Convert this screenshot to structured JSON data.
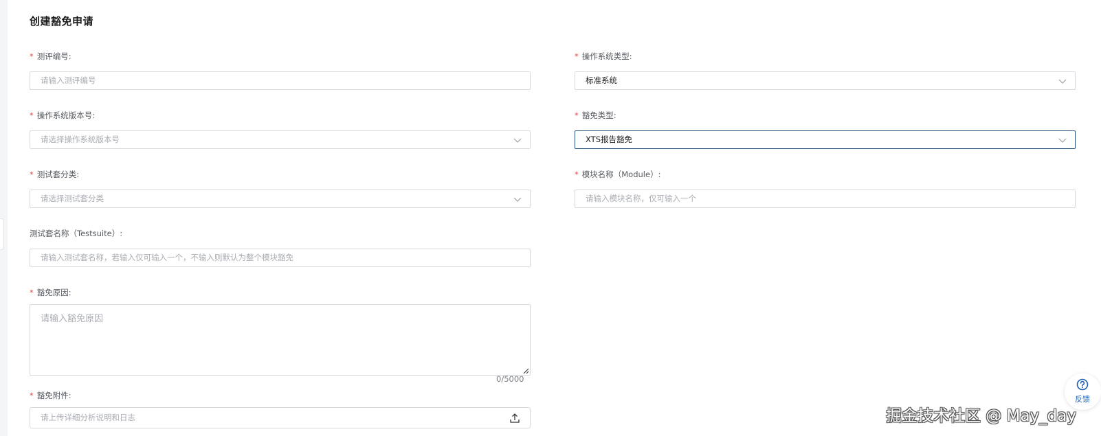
{
  "form": {
    "title": "创建豁免申请",
    "required_mark": "*",
    "left": [
      {
        "label": "测评编号:",
        "required": true,
        "placeholder": "请输入测评编号"
      },
      {
        "label": "操作系统版本号:",
        "required": true,
        "placeholder": "请选择操作系统版本号"
      },
      {
        "label": "测试套分类:",
        "required": true,
        "placeholder": "请选择测试套分类"
      },
      {
        "label": "测试套名称（Testsuite）:",
        "required": false,
        "placeholder": "请输入测试套名称，若输入仅可输入一个，不输入则默认为整个模块豁免"
      },
      {
        "label": "豁免原因:",
        "required": true,
        "placeholder": "请输入豁免原因",
        "counter": "0/5000"
      },
      {
        "label": "豁免附件:",
        "required": true,
        "placeholder": "请上传详细分析说明和日志"
      }
    ],
    "right": [
      {
        "label": "操作系统类型:",
        "required": true,
        "value": "标准系统"
      },
      {
        "label": "豁免类型:",
        "required": true,
        "value": "XTS报告豁免"
      },
      {
        "label": "模块名称（Module）:",
        "required": true,
        "placeholder": "请输入模块名称，仅可输入一个"
      }
    ]
  },
  "help": {
    "label": "反馈",
    "icon": "question-circle-icon"
  },
  "watermark": "掘金技术社区 @ May_day",
  "colors": {
    "accent": "#1e4d78",
    "required": "#e5484d",
    "help": "#1a5fb4"
  }
}
